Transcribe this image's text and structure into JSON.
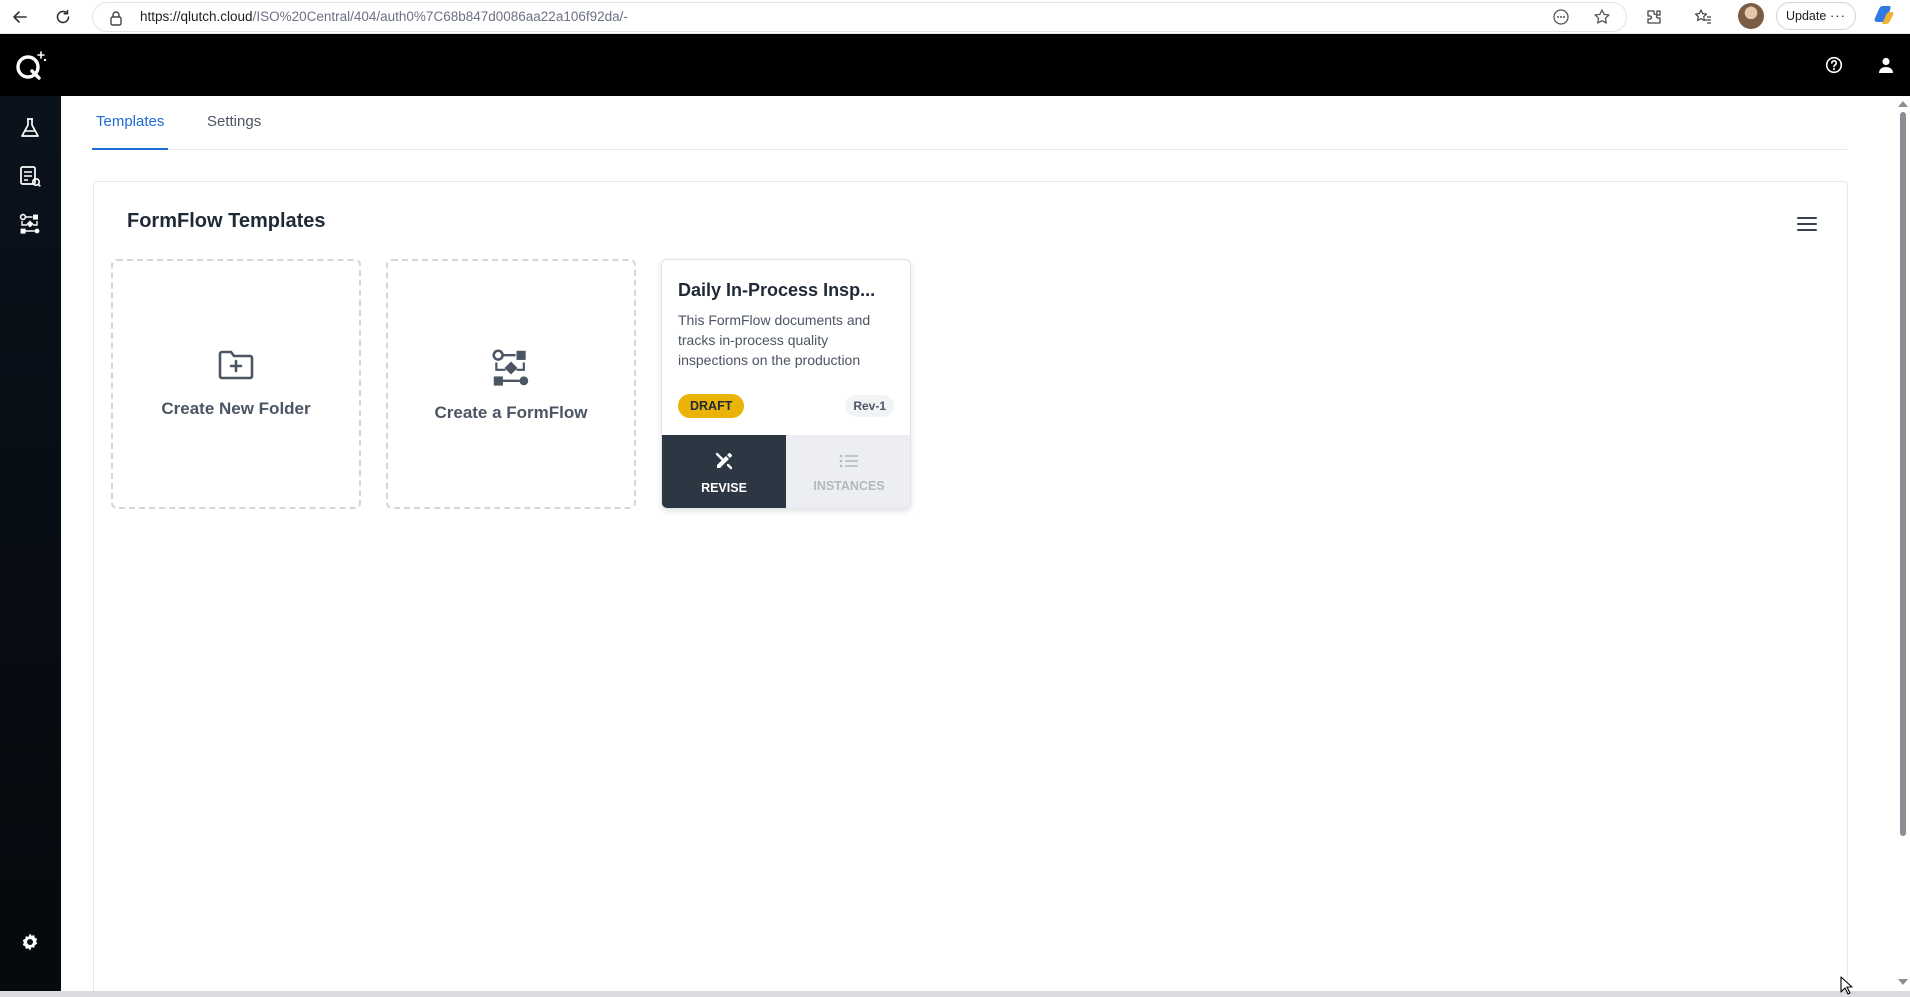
{
  "browser": {
    "url_main": "https://qlutch.cloud",
    "url_path": "/ISO%20Central/404/auth0%7C68b847d0086aa22a106f92da/-",
    "update_label": "Update",
    "more_label": "···",
    "icons": [
      "back-arrow-icon",
      "reload-icon",
      "lock-icon",
      "reading-mode-icon",
      "star-icon",
      "extensions-icon",
      "favorites-icon",
      "profile-avatar",
      "copilot-icon"
    ]
  },
  "header": {
    "icons": [
      "qlutch-logo",
      "help-icon",
      "user-icon"
    ]
  },
  "sidebar": {
    "icons": [
      "flask-icon",
      "document-list-icon",
      "workflow-icon",
      "gear-icon"
    ]
  },
  "tabs": [
    {
      "label": "Templates",
      "active": true
    },
    {
      "label": "Settings",
      "active": false
    }
  ],
  "panel": {
    "title": "FormFlow Templates",
    "create_folder_label": "Create New Folder",
    "create_formflow_label": "Create a FormFlow",
    "template": {
      "title": "Daily In-Process Insp...",
      "description": "This FormFlow documents and tracks in-process quality inspections on the production",
      "status": "DRAFT",
      "revision": "Rev-1",
      "revise_label": "REVISE",
      "instances_label": "INSTANCES"
    }
  },
  "colors": {
    "accent": "#1e6ad6",
    "draft_badge": "#eab308",
    "revise_bg": "#2d3643",
    "header_bg": "#000000"
  }
}
